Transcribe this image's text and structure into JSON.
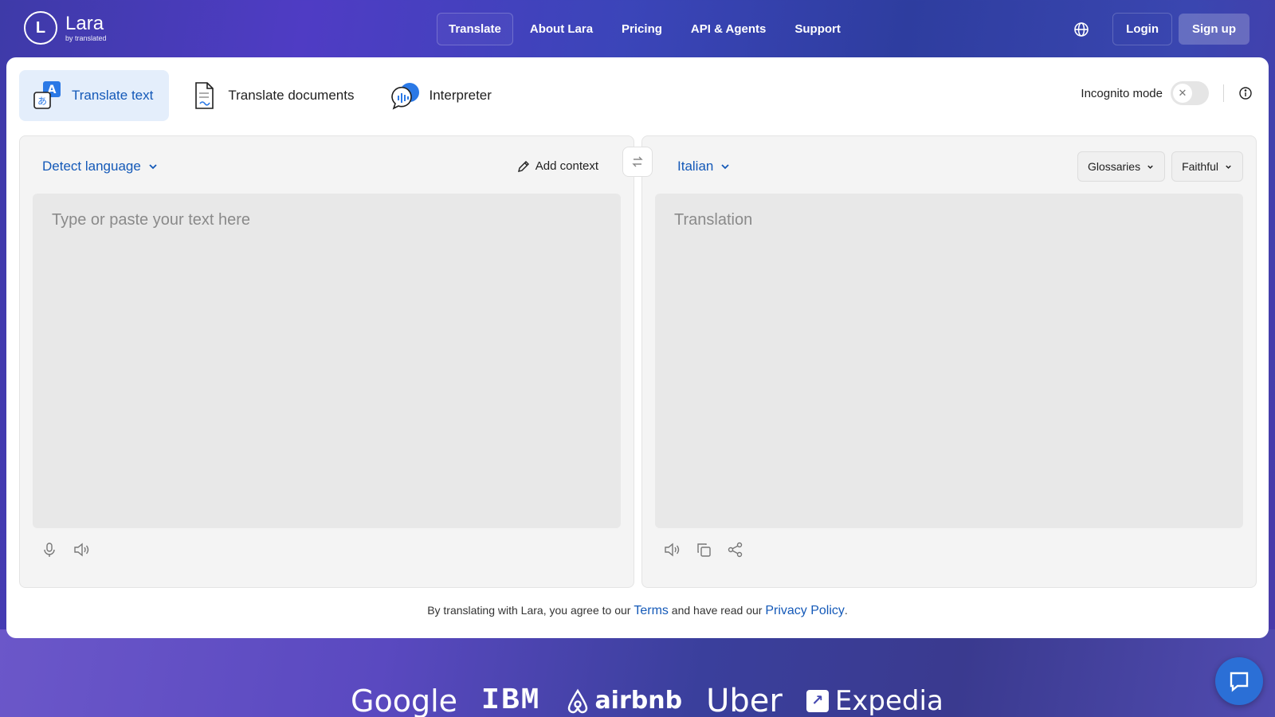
{
  "colors": {
    "accent": "#1459b8",
    "active_tab_bg": "#e4eefb",
    "panel_bg": "#f4f4f4",
    "text_area_bg": "#e8e8e8"
  },
  "brand": {
    "logo_letter": "L",
    "name": "Lara",
    "tagline": "by translated"
  },
  "nav": {
    "items": [
      "Translate",
      "About Lara",
      "Pricing",
      "API & Agents",
      "Support"
    ],
    "active": "Translate"
  },
  "header": {
    "globe_icon": "globe-icon",
    "login_label": "Login",
    "signup_label": "Sign up"
  },
  "tabs": [
    {
      "label": "Translate text",
      "icon": "translate-text-icon",
      "active": true
    },
    {
      "label": "Translate documents",
      "icon": "document-icon",
      "active": false
    },
    {
      "label": "Interpreter",
      "icon": "interpreter-icon",
      "active": false
    }
  ],
  "incognito": {
    "label": "Incognito mode",
    "enabled": false
  },
  "source": {
    "language": "Detect language",
    "add_context_label": "Add context",
    "placeholder": "Type or paste your text here"
  },
  "target": {
    "language": "Italian",
    "glossaries_label": "Glossaries",
    "style_label": "Faithful",
    "placeholder": "Translation"
  },
  "legal": {
    "prefix": "By translating with Lara, you agree to our",
    "terms": "Terms",
    "middle": "and have read our",
    "privacy": "Privacy Policy",
    "suffix": "."
  },
  "brands": {
    "google": "Google",
    "ibm": "IBM",
    "airbnb": "airbnb",
    "uber": "Uber",
    "expedia": "Expedia"
  }
}
